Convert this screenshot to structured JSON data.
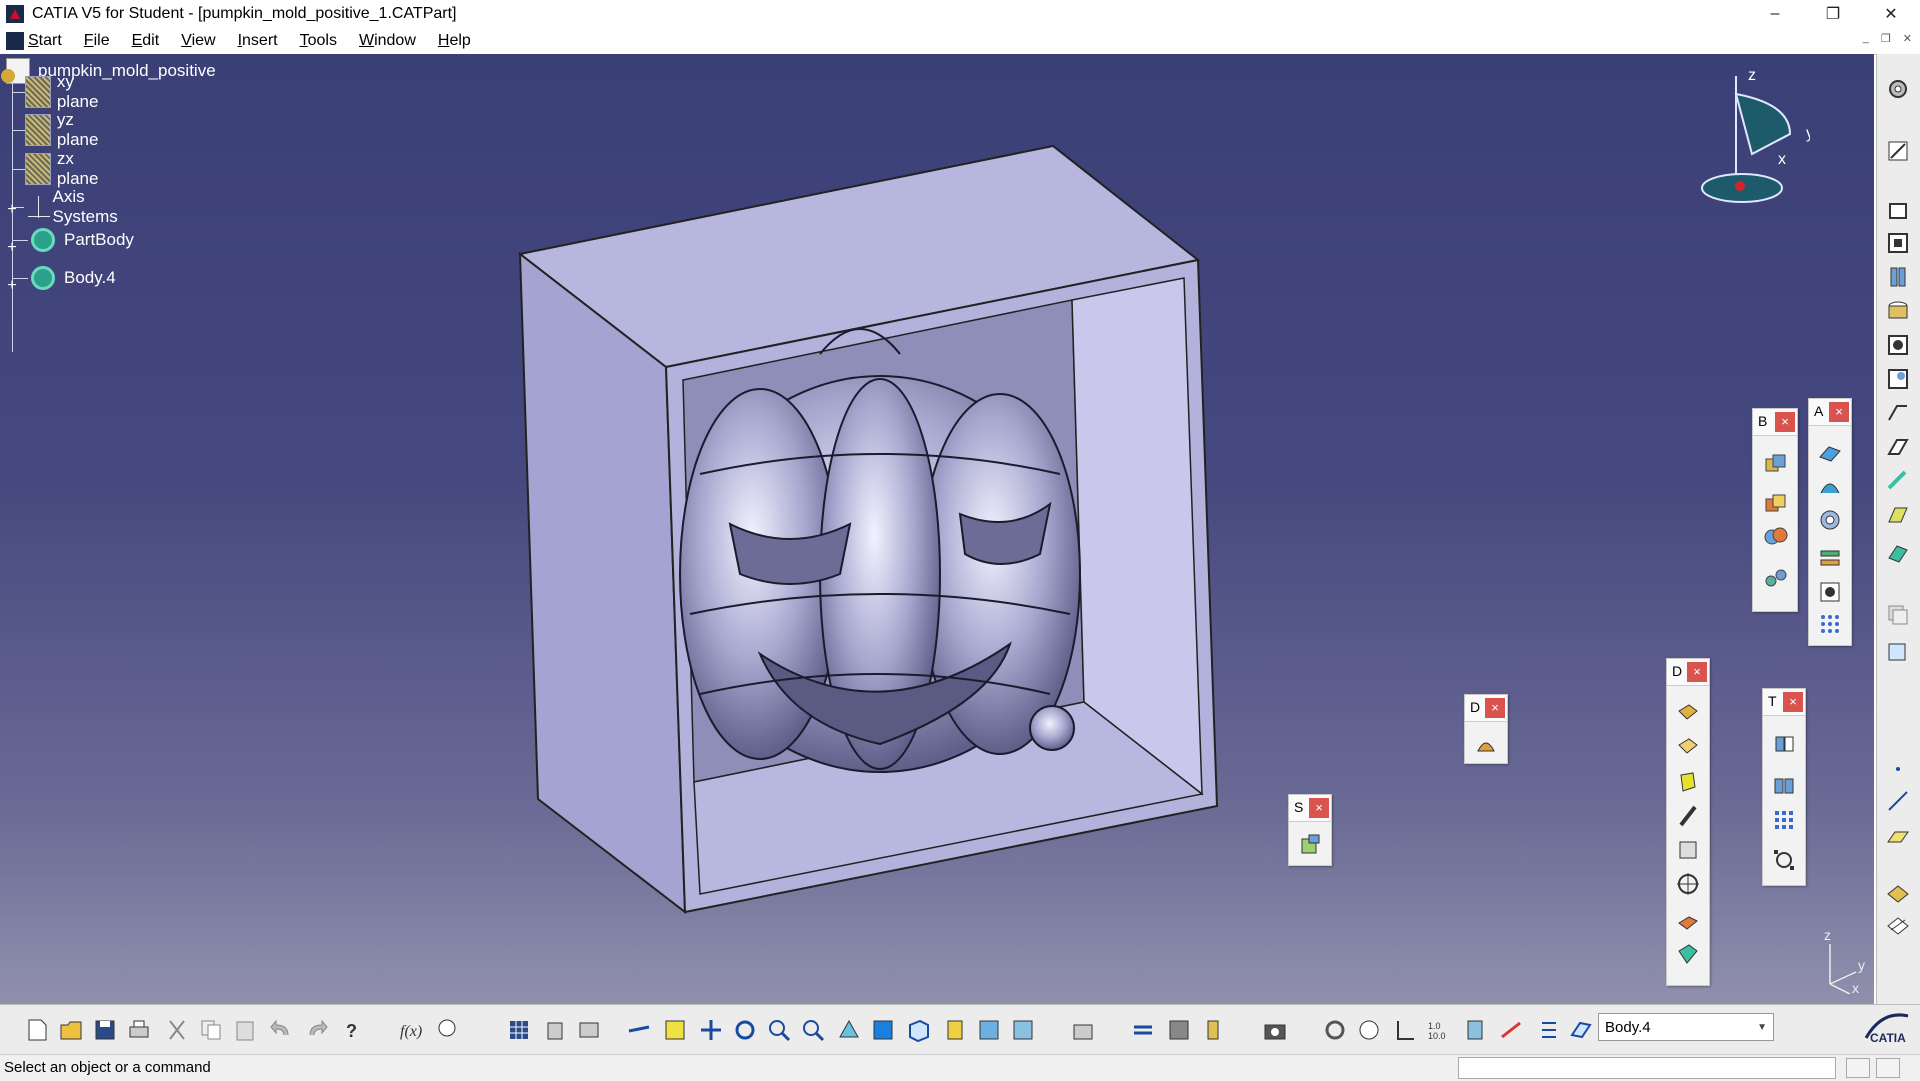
{
  "window": {
    "title": "CATIA V5 for Student - [pumpkin_mold_positive_1.CATPart]",
    "controls": {
      "minimize": "–",
      "maximize": "❐",
      "close": "✕"
    }
  },
  "menu": {
    "items": [
      "Start",
      "File",
      "Edit",
      "View",
      "Insert",
      "Tools",
      "Window",
      "Help"
    ]
  },
  "mdi_controls": {
    "minimize": "_",
    "restore": "❐",
    "close": "✕"
  },
  "tree": {
    "root": "pumpkin_mold_positive",
    "expander": "+",
    "items": [
      {
        "label": "xy plane",
        "icon": "plane-icon"
      },
      {
        "label": "yz plane",
        "icon": "plane-icon"
      },
      {
        "label": "zx plane",
        "icon": "plane-icon"
      },
      {
        "label": "Axis Systems",
        "icon": "axis-system-icon",
        "expandable": true
      },
      {
        "label": "PartBody",
        "icon": "body-icon",
        "expandable": true
      },
      {
        "label": "Body.4",
        "icon": "body-icon",
        "expandable": true
      }
    ]
  },
  "compass": {
    "z": "z",
    "y": "y",
    "x": "x"
  },
  "mini_axes": {
    "z": "z",
    "y": "y",
    "x": "x"
  },
  "floating_toolbars": [
    {
      "letter": "B",
      "close": "×"
    },
    {
      "letter": "A",
      "close": "×"
    },
    {
      "letter": "D",
      "close": "×"
    },
    {
      "letter": "D",
      "close": "×"
    },
    {
      "letter": "T",
      "close": "×"
    },
    {
      "letter": "S",
      "close": "×"
    }
  ],
  "bottom_toolbar": {
    "current_body": "Body.4",
    "logo_text": "CATIA"
  },
  "status": {
    "message": "Select an object or a command"
  },
  "colors": {
    "viewport_top": "#3a3f76",
    "viewport_bottom": "#9090ad",
    "part_face": "#b9b8e0",
    "close_button": "#d9534f"
  }
}
